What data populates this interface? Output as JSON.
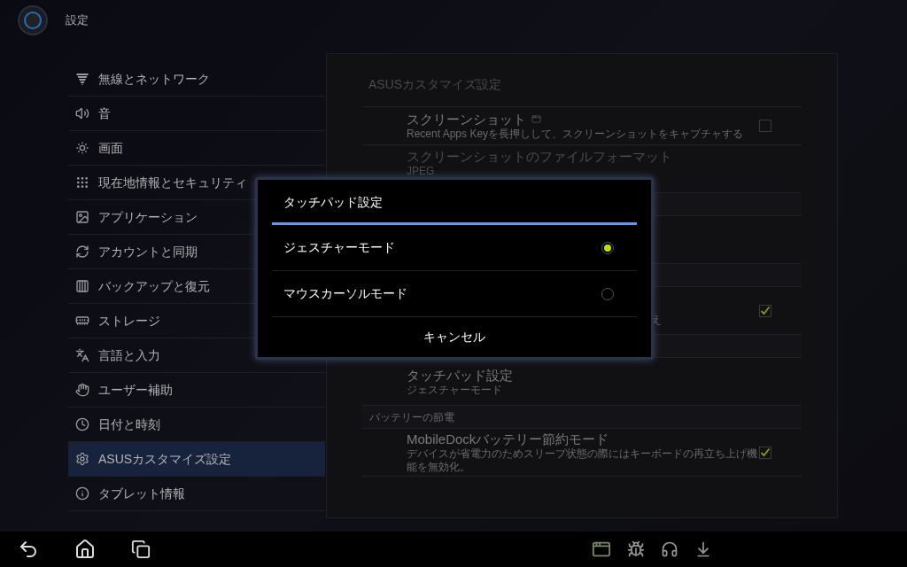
{
  "header": {
    "title": "設定"
  },
  "sidebar": {
    "items": [
      {
        "label": "無線とネットワーク",
        "selected": false
      },
      {
        "label": "音",
        "selected": false
      },
      {
        "label": "画面",
        "selected": false
      },
      {
        "label": "現在地情報とセキュリティ",
        "selected": false
      },
      {
        "label": "アプリケーション",
        "selected": false
      },
      {
        "label": "アカウントと同期",
        "selected": false
      },
      {
        "label": "バックアップと復元",
        "selected": false
      },
      {
        "label": "ストレージ",
        "selected": false
      },
      {
        "label": "言語と入力",
        "selected": false
      },
      {
        "label": "ユーザー補助",
        "selected": false
      },
      {
        "label": "日付と時刻",
        "selected": false
      },
      {
        "label": "ASUSカスタマイズ設定",
        "selected": true
      },
      {
        "label": "タブレット情報",
        "selected": false
      }
    ]
  },
  "panel": {
    "title": "ASUSカスタマイズ設定",
    "rows": [
      {
        "kind": "checkbox",
        "title": "スクリーンショット",
        "has_icon": true,
        "subtitle": "Recent Apps Keyを長押しして、スクリーンショットをキャプチャする",
        "checked": false,
        "disabled": false
      },
      {
        "kind": "item",
        "title": "スクリーンショットのファイルフォーマット",
        "subtitle": "JPEG",
        "disabled": true
      },
      {
        "kind": "section"
      },
      {
        "kind": "item"
      },
      {
        "kind": "section"
      },
      {
        "kind": "checkbox",
        "subtitle": "え",
        "checked": true,
        "disabled": false
      },
      {
        "kind": "section"
      },
      {
        "kind": "item",
        "title": "タッチパッド設定",
        "subtitle": "ジェスチャーモード",
        "disabled": false
      },
      {
        "kind": "section",
        "label": "バッテリーの節電"
      },
      {
        "kind": "checkbox",
        "title": "MobileDockバッテリー節約モード",
        "subtitle": "デバイスが省電力のためスリープ状態の際にはキーボードの再立ち上げ機能を無効化。",
        "checked": true,
        "disabled": false
      }
    ]
  },
  "dialog": {
    "title": "タッチパッド設定",
    "options": [
      {
        "label": "ジェスチャーモード",
        "selected": true
      },
      {
        "label": "マウスカーソルモード",
        "selected": false
      }
    ],
    "cancel": "キャンセル"
  }
}
